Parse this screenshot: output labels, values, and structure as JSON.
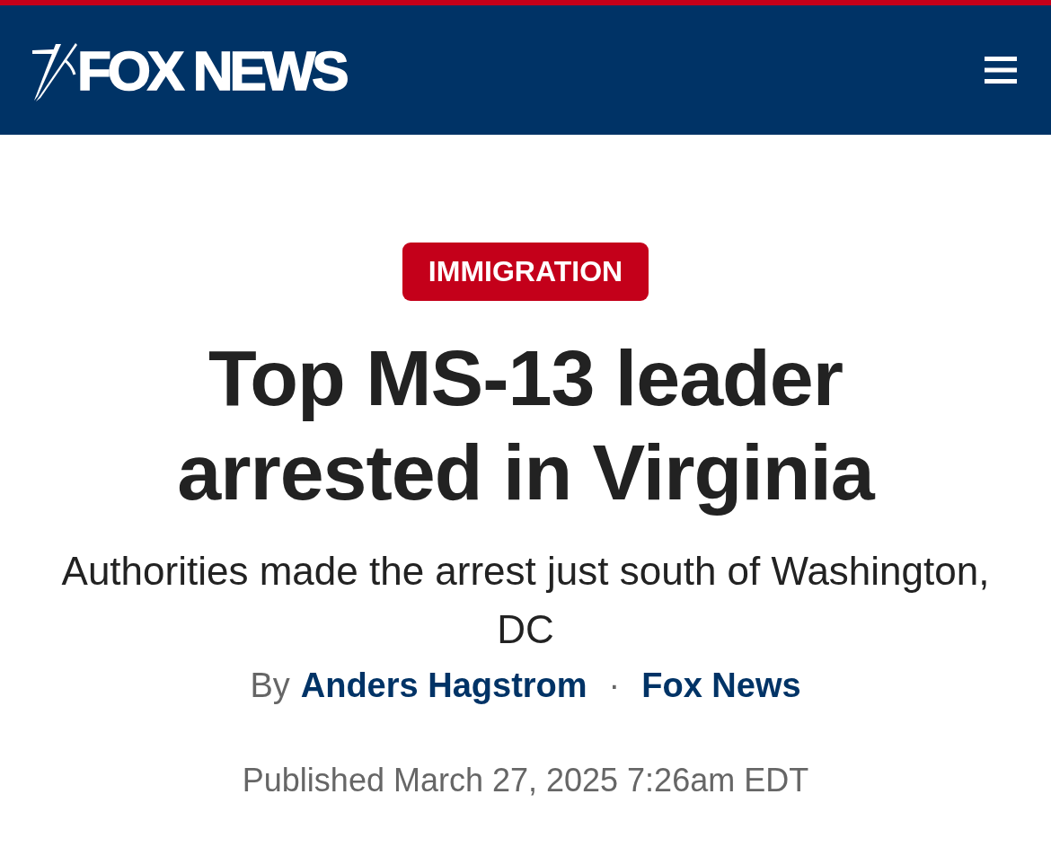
{
  "header": {
    "logo_text": "FOX NEWS"
  },
  "article": {
    "category": "IMMIGRATION",
    "headline": "Top MS-13 leader arrested in Virginia",
    "subheadline": "Authorities made the arrest just south of Washington, DC",
    "byline": {
      "prefix": "By",
      "author": "Anders Hagstrom",
      "separator": "·",
      "source": "Fox News"
    },
    "published": "Published March 27, 2025 7:26am EDT"
  }
}
